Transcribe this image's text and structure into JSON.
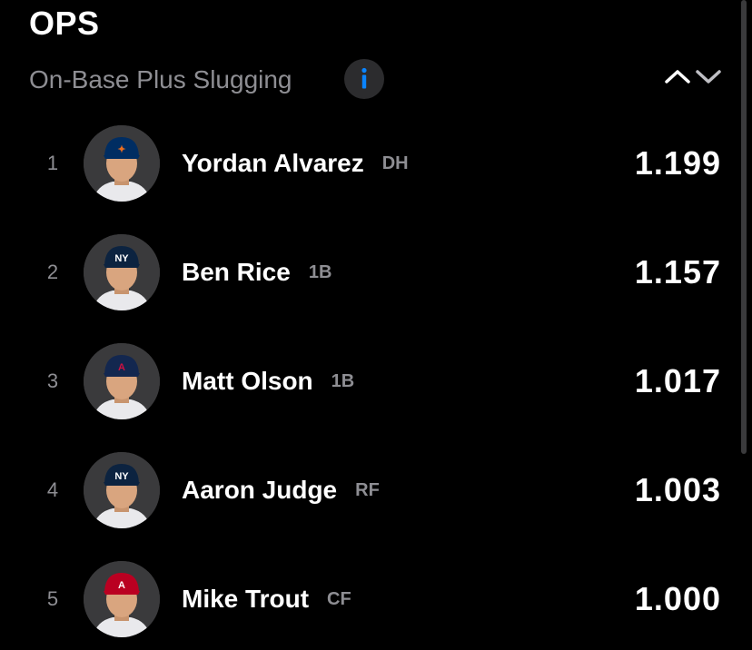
{
  "header": {
    "title": "OPS",
    "subtitle": "On-Base Plus Slugging",
    "info_icon": "info-icon",
    "sort_icon": "chevron-up-down-icon"
  },
  "colors": {
    "background": "#000000",
    "muted_text": "#8e8e93",
    "info_accent": "#0a84ff"
  },
  "leaders": [
    {
      "rank": "1",
      "name": "Yordan Alvarez",
      "position": "DH",
      "value": "1.199",
      "team_color": "#002d62",
      "logo_color": "#eb6e1f"
    },
    {
      "rank": "2",
      "name": "Ben Rice",
      "position": "1B",
      "value": "1.157",
      "team_color": "#0c2340",
      "logo_color": "#ffffff"
    },
    {
      "rank": "3",
      "name": "Matt Olson",
      "position": "1B",
      "value": "1.017",
      "team_color": "#13274f",
      "logo_color": "#ce1141"
    },
    {
      "rank": "4",
      "name": "Aaron Judge",
      "position": "RF",
      "value": "1.003",
      "team_color": "#0c2340",
      "logo_color": "#ffffff"
    },
    {
      "rank": "5",
      "name": "Mike Trout",
      "position": "CF",
      "value": "1.000",
      "team_color": "#ba0021",
      "logo_color": "#ffffff"
    }
  ]
}
